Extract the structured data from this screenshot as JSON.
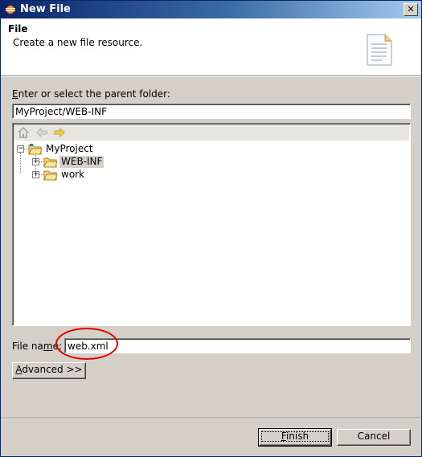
{
  "window": {
    "title": "New File",
    "close_glyph": "✕"
  },
  "header": {
    "title": "File",
    "description": "Create a new file resource.",
    "icon": "document-icon"
  },
  "parent_folder": {
    "label_prefix": "E",
    "label_rest": "nter or select the parent folder:",
    "value": "MyProject/WEB-INF"
  },
  "tree": {
    "toolbar": [
      "home-icon",
      "back-arrow-icon",
      "forward-arrow-icon"
    ],
    "nodes": [
      {
        "label": "MyProject",
        "expander": "−"
      },
      {
        "label": "WEB-INF",
        "expander": "+"
      },
      {
        "label": "work",
        "expander": "+"
      }
    ]
  },
  "file_name": {
    "label_prefix": "File na",
    "label_u": "m",
    "label_rest": "e:",
    "value": "web.xml"
  },
  "advanced_button": {
    "label_u": "A",
    "label_rest": "dvanced >>"
  },
  "finish_button": {
    "label_u": "F",
    "label_rest": "inish"
  },
  "cancel_button": {
    "label": "Cancel"
  },
  "colors": {
    "title_bar": "#0a246a",
    "face": "#d4d0c8",
    "annotation": "#e00000"
  }
}
